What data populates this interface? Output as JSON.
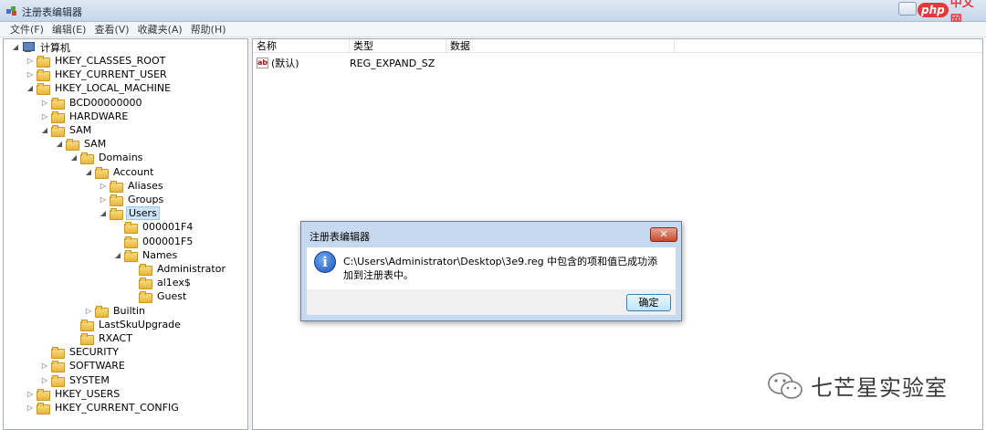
{
  "window": {
    "title": "注册表编辑器",
    "menu": [
      "文件(F)",
      "编辑(E)",
      "查看(V)",
      "收藏夹(A)",
      "帮助(H)"
    ]
  },
  "watermark_top": {
    "badge": "php",
    "text": "中文网"
  },
  "tree": {
    "root": "计算机",
    "rows": [
      {
        "label": "HKEY_CLASSES_ROOT",
        "exp": "▷",
        "depth": 1
      },
      {
        "label": "HKEY_CURRENT_USER",
        "exp": "▷",
        "depth": 1
      },
      {
        "label": "HKEY_LOCAL_MACHINE",
        "exp": "◢",
        "depth": 1
      },
      {
        "label": "BCD00000000",
        "exp": "▷",
        "depth": 2
      },
      {
        "label": "HARDWARE",
        "exp": "▷",
        "depth": 2
      },
      {
        "label": "SAM",
        "exp": "◢",
        "depth": 2
      },
      {
        "label": "SAM",
        "exp": "◢",
        "depth": 3
      },
      {
        "label": "Domains",
        "exp": "◢",
        "depth": 4
      },
      {
        "label": "Account",
        "exp": "◢",
        "depth": 5
      },
      {
        "label": "Aliases",
        "exp": "▷",
        "depth": 6
      },
      {
        "label": "Groups",
        "exp": "▷",
        "depth": 6
      },
      {
        "label": "Users",
        "exp": "◢",
        "depth": 6,
        "selected": true
      },
      {
        "label": "000001F4",
        "exp": "",
        "depth": 7
      },
      {
        "label": "000001F5",
        "exp": "",
        "depth": 7
      },
      {
        "label": "Names",
        "exp": "◢",
        "depth": 7
      },
      {
        "label": "Administrator",
        "exp": "",
        "depth": 8
      },
      {
        "label": "al1ex$",
        "exp": "",
        "depth": 8
      },
      {
        "label": "Guest",
        "exp": "",
        "depth": 8
      },
      {
        "label": "Builtin",
        "exp": "▷",
        "depth": 5
      },
      {
        "label": "LastSkuUpgrade",
        "exp": "",
        "depth": 4
      },
      {
        "label": "RXACT",
        "exp": "",
        "depth": 4
      },
      {
        "label": "SECURITY",
        "exp": "",
        "depth": 2
      },
      {
        "label": "SOFTWARE",
        "exp": "▷",
        "depth": 2
      },
      {
        "label": "SYSTEM",
        "exp": "▷",
        "depth": 2
      },
      {
        "label": "HKEY_USERS",
        "exp": "▷",
        "depth": 1
      },
      {
        "label": "HKEY_CURRENT_CONFIG",
        "exp": "▷",
        "depth": 1
      }
    ]
  },
  "list": {
    "columns": [
      "名称",
      "类型",
      "数据"
    ],
    "rows": [
      {
        "name": "(默认)",
        "type": "REG_EXPAND_SZ",
        "data": ""
      }
    ]
  },
  "dialog": {
    "title": "注册表编辑器",
    "close": "✕",
    "icon": "i",
    "message": "C:\\Users\\Administrator\\Desktop\\3e9.reg 中包含的项和值已成功添加到注册表中。",
    "ok_label": "确定"
  },
  "watermark_bottom": {
    "text": "七芒星实验室"
  },
  "colors": {
    "selection": "#cce4f7",
    "dialog_frame": "#c6d9ef",
    "close_red": "#c54a2d"
  }
}
